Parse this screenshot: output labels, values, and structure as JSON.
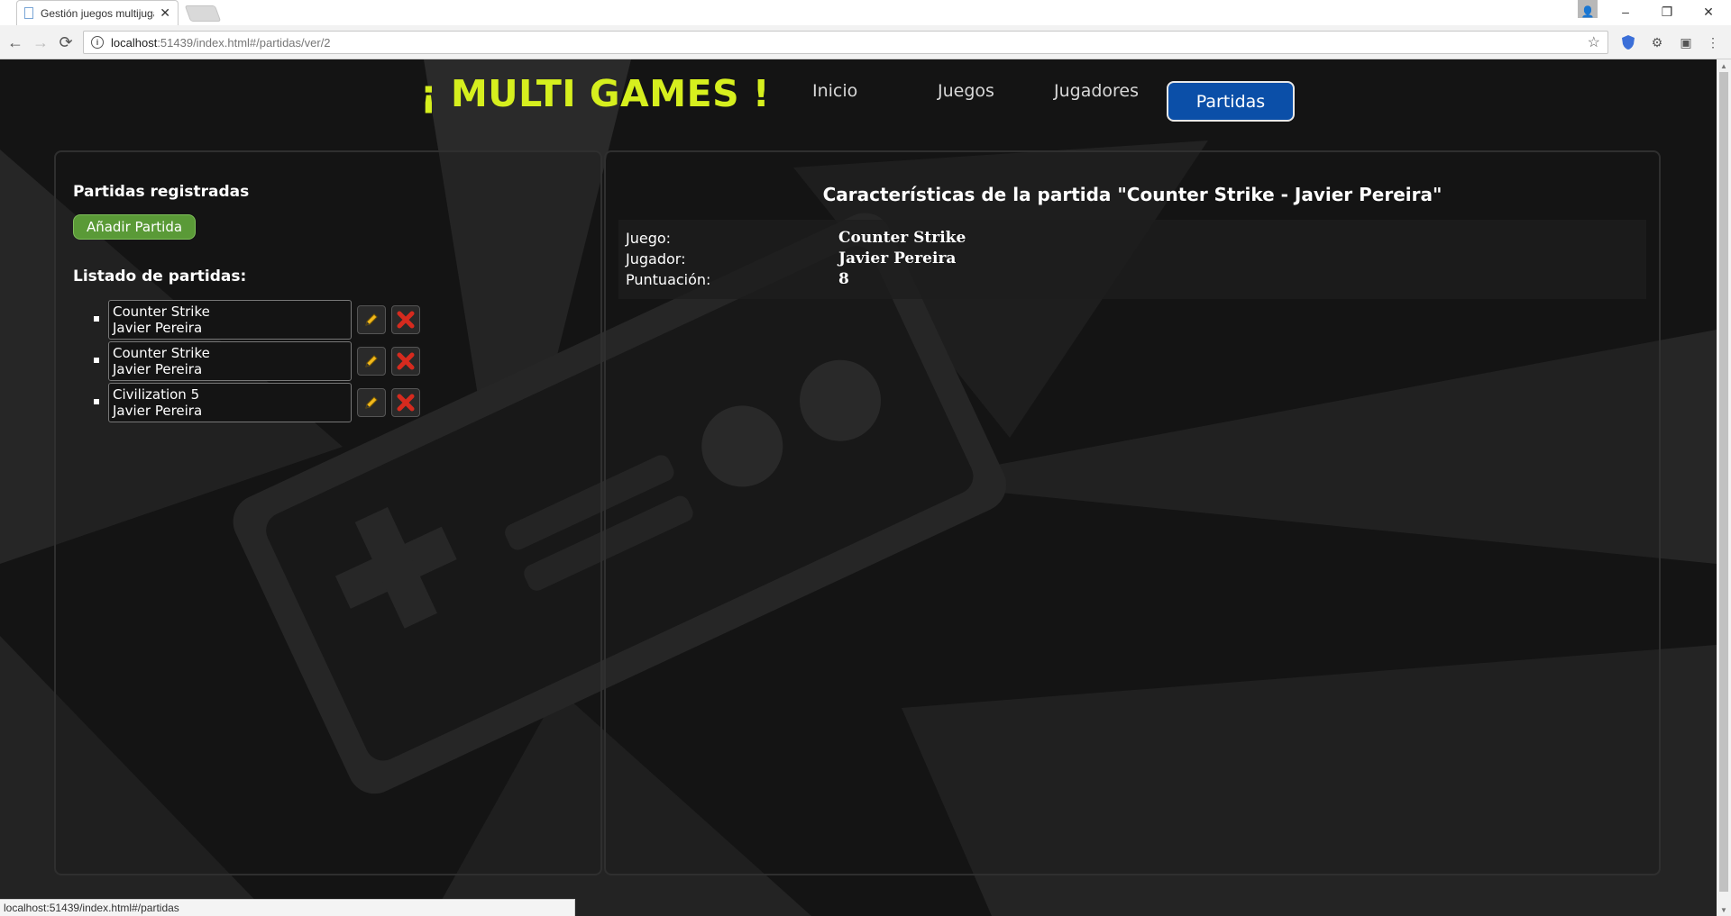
{
  "browser": {
    "tab_title": "Gestión juegos multijuga",
    "tab_close": "✕",
    "url_host": "localhost",
    "url_path": ":51439/index.html#/partidas/ver/2",
    "status_url": "localhost:51439/index.html#/partidas",
    "window_buttons": {
      "minimize": "–",
      "maximize": "❐",
      "close": "✕"
    }
  },
  "site": {
    "brand": "¡ MULTI GAMES !",
    "nav": [
      {
        "label": "Inicio",
        "active": false
      },
      {
        "label": "Juegos",
        "active": false
      },
      {
        "label": "Jugadores",
        "active": false
      },
      {
        "label": "Partidas",
        "active": true
      }
    ]
  },
  "sidebar": {
    "heading": "Partidas registradas",
    "add_button": "Añadir Partida",
    "list_heading": "Listado de partidas:",
    "items": [
      {
        "game": "Counter Strike",
        "player": "Javier Pereira"
      },
      {
        "game": "Counter Strike",
        "player": "Javier Pereira"
      },
      {
        "game": "Civilization 5",
        "player": "Javier Pereira"
      }
    ]
  },
  "detail": {
    "title": "Características de la partida \"Counter Strike - Javier Pereira\"",
    "rows": [
      {
        "label": "Juego:",
        "value": "Counter Strike"
      },
      {
        "label": "Jugador:",
        "value": "Javier Pereira"
      },
      {
        "label": "Puntuación:",
        "value": "8"
      }
    ]
  },
  "colors": {
    "brand": "#d6ef1e",
    "active_nav": "#0b4fa8",
    "add_button": "#5a9a37",
    "delete_icon": "#d62a1e",
    "edit_icon": "#f2b81c"
  },
  "icons": {
    "edit": "pencil-icon",
    "delete": "delete-x-icon"
  }
}
